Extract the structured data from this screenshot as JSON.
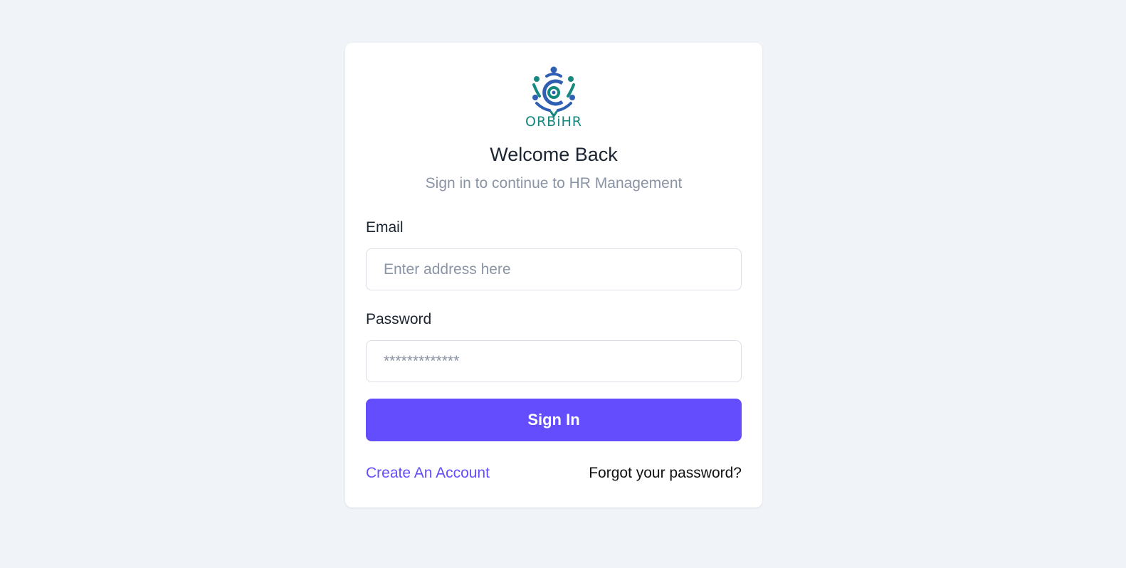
{
  "brand": {
    "logo_text": "ORBiHR",
    "logo_icon": "people-circle-logo-icon",
    "colors": {
      "teal": "#14877f",
      "blue": "#2f5fb3"
    }
  },
  "header": {
    "title": "Welcome Back",
    "subtitle": "Sign in to continue to HR Management"
  },
  "form": {
    "email_label": "Email",
    "email_placeholder": "Enter address here",
    "email_value": "",
    "password_label": "Password",
    "password_placeholder": "*************",
    "password_value": "",
    "submit_label": "Sign In"
  },
  "footer": {
    "create_account": "Create An Account",
    "forgot_password": "Forgot your password?"
  },
  "colors": {
    "accent": "#634dfd",
    "background": "#f0f3f8",
    "card": "#ffffff"
  }
}
